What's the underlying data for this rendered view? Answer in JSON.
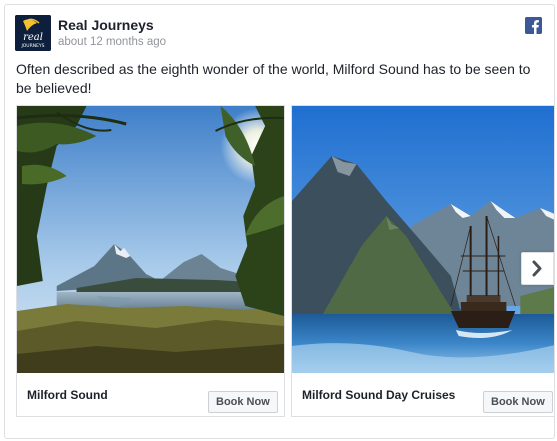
{
  "post": {
    "page_name": "Real Journeys",
    "time": "about 12 months ago",
    "text": "Often described as the eighth wonder of the world, Milford Sound has to be seen to be believed!",
    "logo_text": "real journeys"
  },
  "carousel": {
    "cards": [
      {
        "title": "Milford Sound",
        "button": "Book Now",
        "image": "lake-mountain-photo"
      },
      {
        "title": "Milford Sound Day Cruises",
        "button": "Book Now",
        "image": "ship-fjord-photo"
      }
    ],
    "next_icon": "chevron-right-icon"
  },
  "icons": {
    "facebook": "facebook-icon"
  },
  "colors": {
    "facebook_blue": "#3b5998",
    "text": "#1d2129",
    "meta": "#90949c"
  }
}
